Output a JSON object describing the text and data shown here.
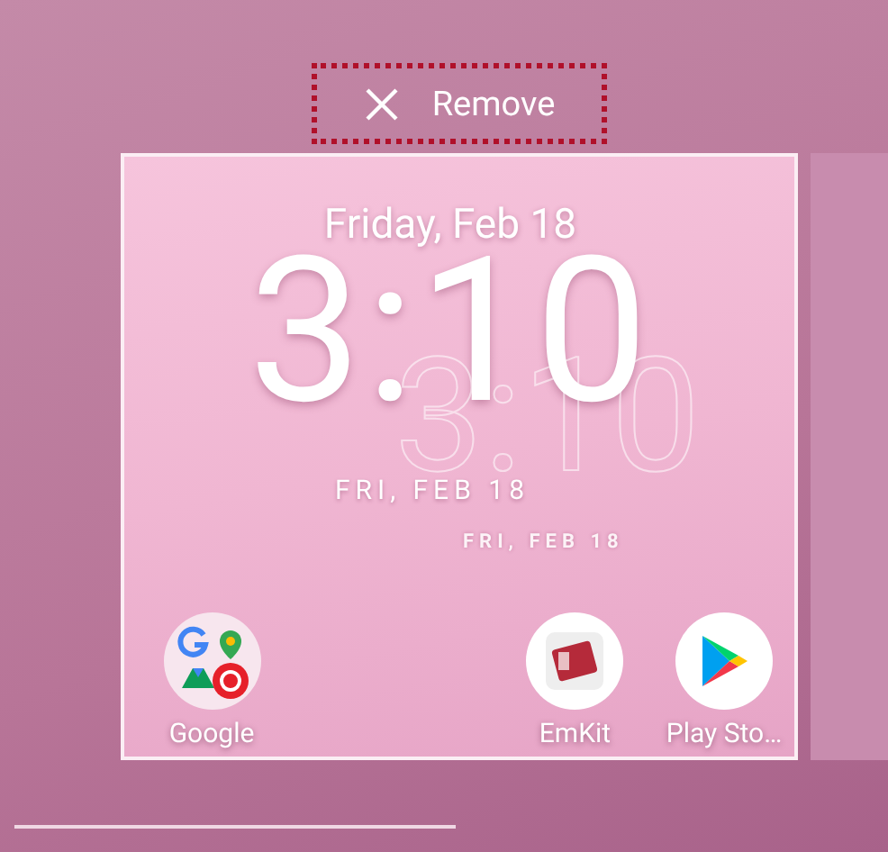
{
  "remove_button": {
    "label": "Remove",
    "highlighted": true
  },
  "card": {
    "date": "Friday, Feb 18",
    "time": "3:10",
    "short_date": "FRI, FEB 18",
    "ghost_time": "3:10",
    "ghost_date": "FRI, FEB 18",
    "apps": [
      {
        "kind": "folder",
        "label": "Google"
      },
      {
        "kind": "emkit",
        "label": "EmKit"
      },
      {
        "kind": "play",
        "label": "Play Sto…"
      }
    ]
  }
}
